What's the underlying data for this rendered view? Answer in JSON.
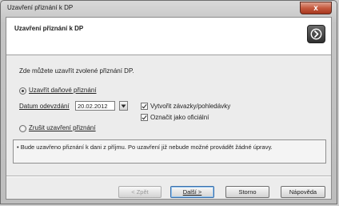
{
  "window": {
    "title": "Uzavření přiznání k DP",
    "close_label": "x"
  },
  "header": {
    "title": "Uzavření přiznání k DP",
    "icon": "wizard-arrow-icon"
  },
  "main": {
    "intro": "Zde můžete uzavřít zvolené přiznání DP.",
    "option_close": {
      "label": "Uzavřít daňové přiznání",
      "selected": true
    },
    "date_label": "Datum odevzdání",
    "date_value": "20.02.2012",
    "checkbox_liabilities": {
      "label": "Vytvořit závazky/pohledávky",
      "checked": true
    },
    "checkbox_official": {
      "label": "Označit jako oficiální",
      "checked": true
    },
    "option_cancel": {
      "label": "Zrušit uzavření přiznání",
      "selected": false
    },
    "info_text": "• Bude uzavřeno přiznání k dani z příjmu. Po uzavření již nebude možné provádět žádné úpravy."
  },
  "buttons": {
    "back": "< Zpět",
    "next": "Další >",
    "cancel": "Storno",
    "help": "Nápověda"
  }
}
